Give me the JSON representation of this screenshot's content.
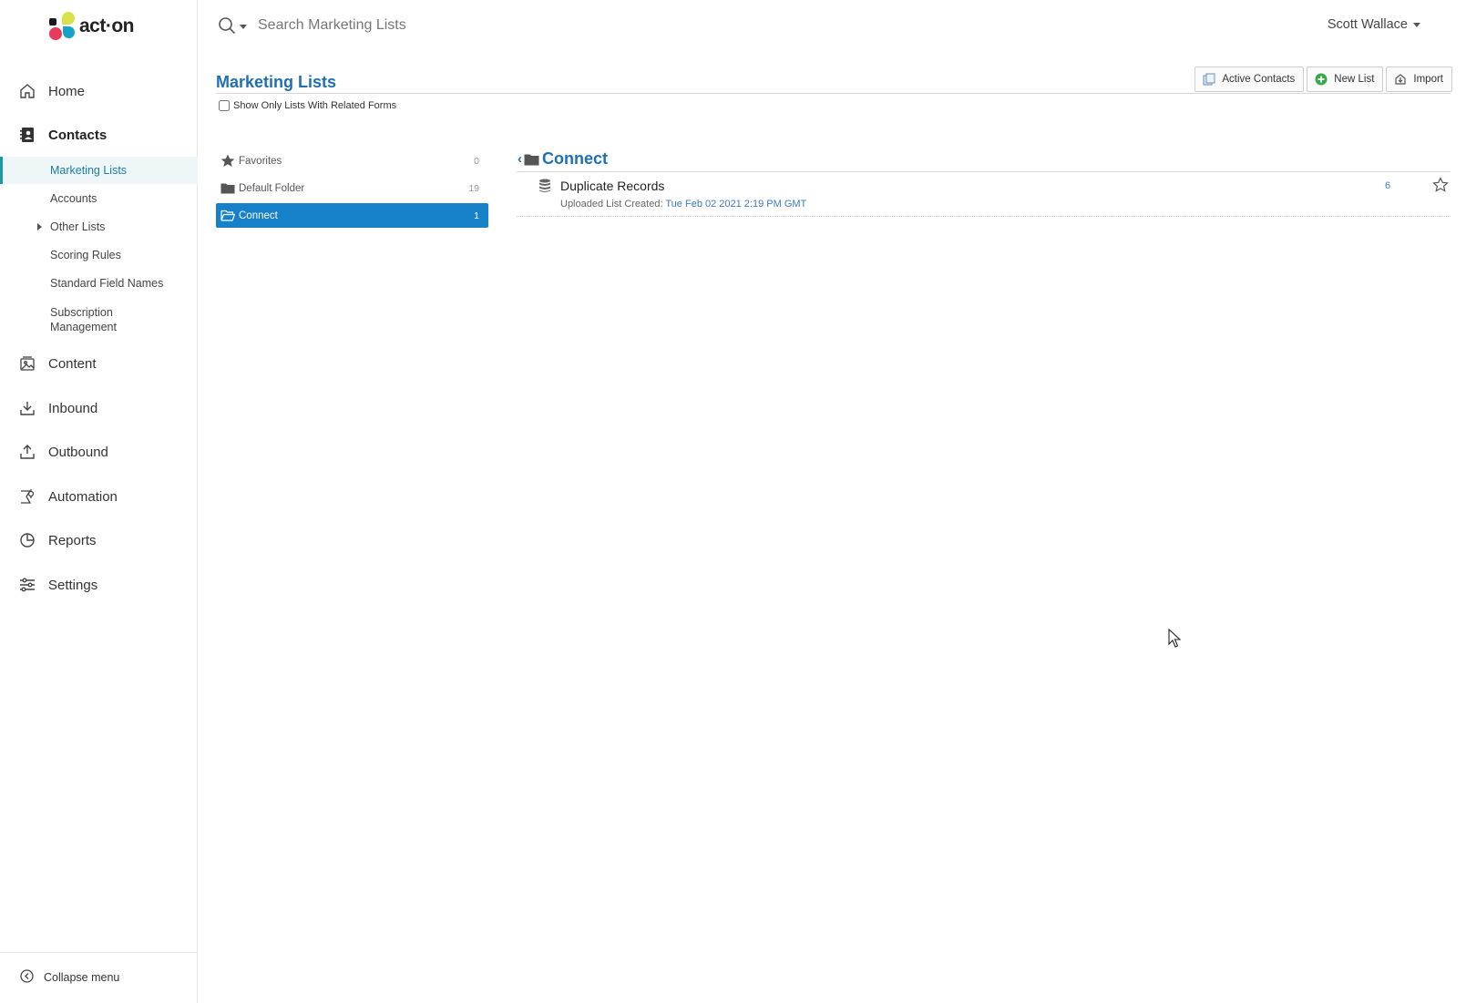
{
  "brand": {
    "name": "act·on"
  },
  "search": {
    "placeholder": "Search Marketing Lists"
  },
  "user": {
    "name": "Scott Wallace"
  },
  "sidebar": {
    "nav": [
      {
        "label": "Home",
        "icon": "home-icon"
      },
      {
        "label": "Contacts",
        "icon": "contacts-icon",
        "active": true
      },
      {
        "label": "Content",
        "icon": "content-icon"
      },
      {
        "label": "Inbound",
        "icon": "inbound-icon"
      },
      {
        "label": "Outbound",
        "icon": "outbound-icon"
      },
      {
        "label": "Automation",
        "icon": "automation-icon"
      },
      {
        "label": "Reports",
        "icon": "reports-icon"
      },
      {
        "label": "Settings",
        "icon": "settings-icon"
      }
    ],
    "contacts_sub": [
      {
        "label": "Marketing Lists",
        "selected": true
      },
      {
        "label": "Accounts"
      },
      {
        "label": "Other Lists",
        "expandable": true
      },
      {
        "label": "Scoring Rules"
      },
      {
        "label": "Standard Field Names"
      },
      {
        "label": "Subscription Management"
      }
    ],
    "collapse_label": "Collapse menu"
  },
  "page": {
    "title": "Marketing Lists",
    "related_forms_label": "Show Only Lists With Related Forms",
    "toolbar": {
      "active_contacts": "Active Contacts",
      "new_list": "New List",
      "import": "Import"
    }
  },
  "folders": [
    {
      "label": "Favorites",
      "count": "0",
      "icon": "star-icon"
    },
    {
      "label": "Default Folder",
      "count": "19",
      "icon": "folder-icon"
    },
    {
      "label": "Connect",
      "count": "1",
      "icon": "folder-open-icon",
      "selected": true
    }
  ],
  "current_folder": {
    "title": "Connect",
    "lists": [
      {
        "name": "Duplicate Records",
        "meta_prefix": "Uploaded List Created:",
        "created": "Tue Feb 02 2021 2:19 PM GMT",
        "count": "6"
      }
    ]
  },
  "colors": {
    "accent": "#1f6fb2",
    "selected_folder": "#1680c8",
    "nav_selected": "#1a9aa7"
  }
}
